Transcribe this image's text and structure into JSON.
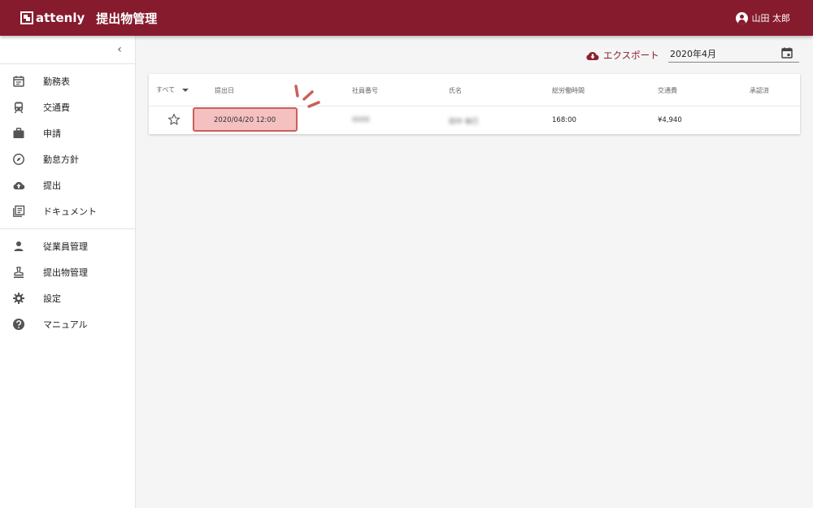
{
  "header": {
    "logo_text": "attenly",
    "title": "提出物管理",
    "user_name": "山田 太郎",
    "bg_color": "#861b2d"
  },
  "sidebar": {
    "collapse_icon": "chevron-left-icon",
    "items": [
      {
        "label": "勤務表",
        "icon": "calendar-icon"
      },
      {
        "label": "交通費",
        "icon": "train-icon"
      },
      {
        "label": "申請",
        "icon": "briefcase-icon"
      },
      {
        "label": "勤怠方針",
        "icon": "compass-icon"
      },
      {
        "label": "提出",
        "icon": "cloud-upload-icon"
      },
      {
        "label": "ドキュメント",
        "icon": "library-books-icon"
      },
      {
        "label": "従業員管理",
        "icon": "person-icon"
      },
      {
        "label": "提出物管理",
        "icon": "stamp-icon"
      },
      {
        "label": "設定",
        "icon": "gear-icon"
      },
      {
        "label": "マニュアル",
        "icon": "help-icon"
      }
    ]
  },
  "toolbar": {
    "export_label": "エクスポート",
    "month_value": "2020年4月"
  },
  "table": {
    "filter_label": "すべて",
    "columns": [
      "提出日",
      "社員番号",
      "氏名",
      "総労働時間",
      "交通費",
      "承認済"
    ],
    "rows": [
      {
        "submitted_at": "2020/04/20 12:00",
        "employee_no": "0000",
        "name": "田中 裕巳",
        "total_hours": "168:00",
        "transport": "¥4,940",
        "approved": ""
      }
    ]
  },
  "accent_color": "#c9605a"
}
